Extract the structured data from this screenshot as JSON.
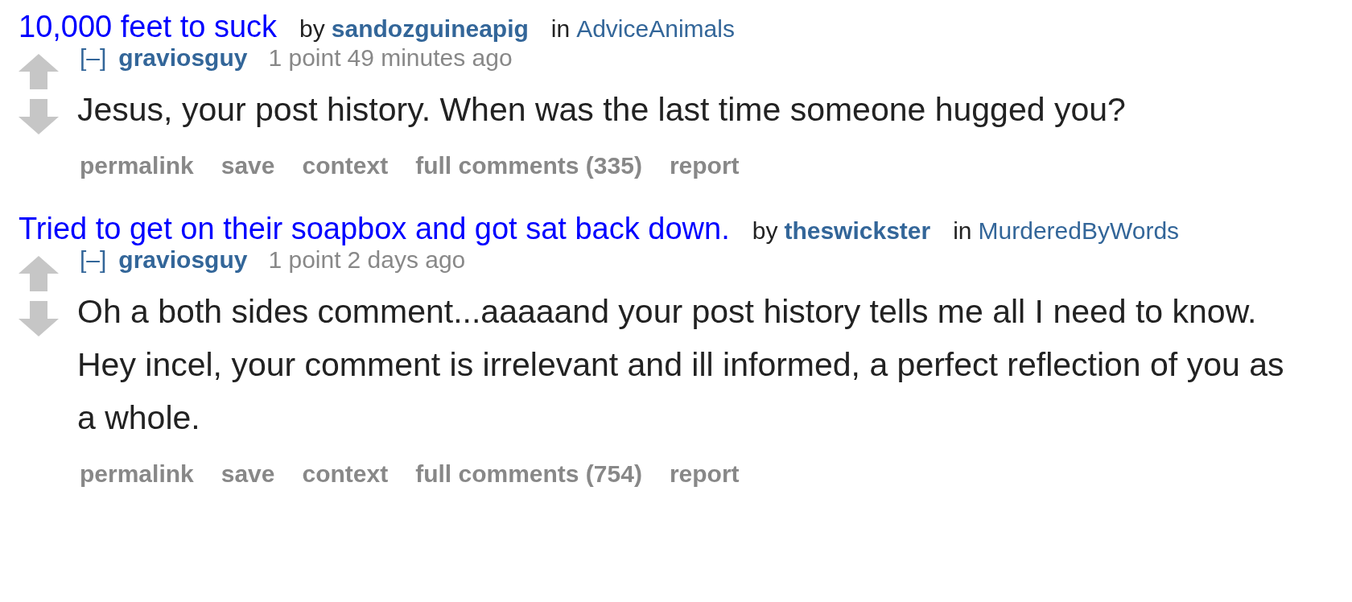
{
  "entries": [
    {
      "title": "10,000 feet to suck",
      "by": "by",
      "author": "sandozguineapig",
      "in": "in",
      "subreddit": "AdviceAnimals",
      "comment": {
        "collapse": "[–]",
        "user": "graviosguy",
        "score": "1 point",
        "time": "49 minutes ago",
        "paragraphs": [
          "Jesus, your post history. When was the last time someone hugged you?"
        ],
        "buttons": [
          "permalink",
          "save",
          "context",
          "full comments (335)",
          "report"
        ]
      }
    },
    {
      "title": "Tried to get on their soapbox and got sat back down.",
      "by": "by",
      "author": "theswickster",
      "in": "in",
      "subreddit": "MurderedByWords",
      "comment": {
        "collapse": "[–]",
        "user": "graviosguy",
        "score": "1 point",
        "time": "2 days ago",
        "paragraphs": [
          "Oh a both sides comment...aaaaand your post history tells me all I need to know.",
          "Hey incel, your comment is irrelevant and ill informed, a perfect reflection of you as a whole."
        ],
        "buttons": [
          "permalink",
          "save",
          "context",
          "full comments (754)",
          "report"
        ]
      }
    }
  ]
}
